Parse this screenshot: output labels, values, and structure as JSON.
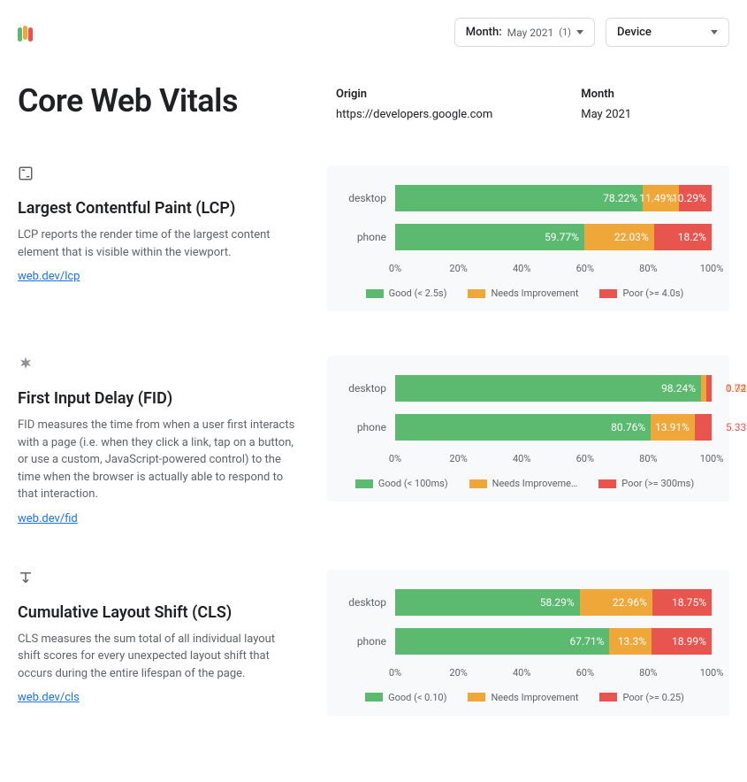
{
  "filters": {
    "month_label": "Month:",
    "month_value": "May 2021",
    "month_count": "(1)",
    "device_label": "Device"
  },
  "title": "Core Web Vitals",
  "meta": {
    "origin_label": "Origin",
    "origin_value": "https://developers.google.com",
    "month_label": "Month",
    "month_value": "May 2021"
  },
  "metrics": [
    {
      "key": "lcp",
      "title": "Largest Contentful Paint (LCP)",
      "desc": "LCP reports the render time of the largest content element that is visible within the viewport.",
      "link": "web.dev/lcp",
      "legend_good": "Good (< 2.5s)",
      "legend_ni": "Needs Improvement",
      "legend_poor": "Poor (>= 4.0s)"
    },
    {
      "key": "fid",
      "title": "First Input Delay (FID)",
      "desc": "FID measures the time from when a user first interacts with a page (i.e. when they click a link, tap on a button, or use a custom, JavaScript-powered control) to the time when the browser is actually able to respond to that interaction.",
      "link": "web.dev/fid",
      "legend_good": "Good (< 100ms)",
      "legend_ni": "Needs Improveme…",
      "legend_poor": "Poor (>= 300ms)"
    },
    {
      "key": "cls",
      "title": "Cumulative Layout Shift (CLS)",
      "desc": "CLS measures the sum total of all individual layout shift scores for every unexpected layout shift that occurs during the entire lifespan of the page.",
      "link": "web.dev/cls",
      "legend_good": "Good (< 0.10)",
      "legend_ni": "Needs Improvement",
      "legend_poor": "Poor (>= 0.25)"
    }
  ],
  "axis_ticks": [
    "0%",
    "20%",
    "40%",
    "60%",
    "80%",
    "100%"
  ],
  "chart_data": [
    {
      "metric": "lcp",
      "type": "bar",
      "title": "Largest Contentful Paint (LCP)",
      "xlabel": "",
      "ylabel": "",
      "xlim": [
        0,
        100
      ],
      "categories": [
        "desktop",
        "phone"
      ],
      "series": [
        {
          "name": "Good (< 2.5s)",
          "values": [
            78.22,
            59.77
          ]
        },
        {
          "name": "Needs Improvement",
          "values": [
            11.49,
            22.03
          ]
        },
        {
          "name": "Poor (>= 4.0s)",
          "values": [
            10.29,
            18.2
          ]
        }
      ]
    },
    {
      "metric": "fid",
      "type": "bar",
      "title": "First Input Delay (FID)",
      "xlabel": "",
      "ylabel": "",
      "xlim": [
        0,
        100
      ],
      "categories": [
        "desktop",
        "phone"
      ],
      "series": [
        {
          "name": "Good (< 100ms)",
          "values": [
            98.24,
            80.76
          ]
        },
        {
          "name": "Needs Improvement",
          "values": [
            1.04,
            13.91
          ]
        },
        {
          "name": "Poor (>= 300ms)",
          "values": [
            0.72,
            5.33
          ]
        }
      ]
    },
    {
      "metric": "cls",
      "type": "bar",
      "title": "Cumulative Layout Shift (CLS)",
      "xlabel": "",
      "ylabel": "",
      "xlim": [
        0,
        100
      ],
      "categories": [
        "desktop",
        "phone"
      ],
      "series": [
        {
          "name": "Good (< 0.10)",
          "values": [
            58.29,
            67.71
          ]
        },
        {
          "name": "Needs Improvement",
          "values": [
            22.96,
            13.3
          ]
        },
        {
          "name": "Poor (>= 0.25)",
          "values": [
            18.75,
            18.99
          ]
        }
      ]
    }
  ],
  "colors": {
    "good": "#5bba6f",
    "ni": "#f0a73a",
    "poor": "#e8554e"
  }
}
